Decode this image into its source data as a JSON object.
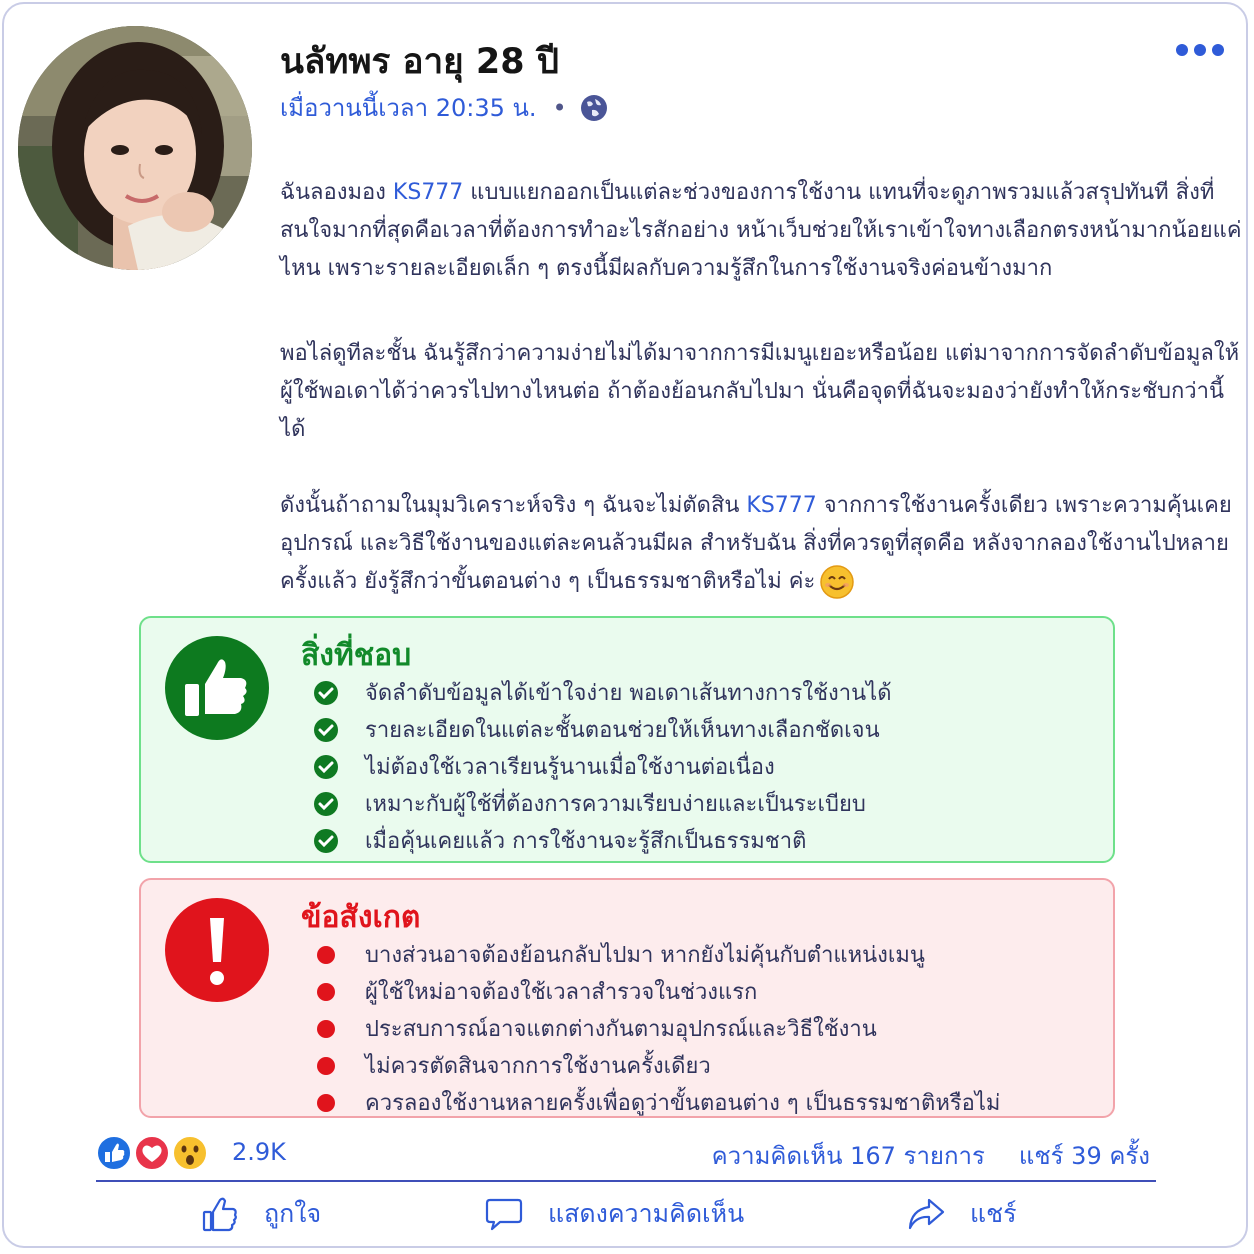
{
  "post": {
    "author": "นลัทพร อายุ 28 ปี",
    "time": "เมื่อวานนี้เวลา 20:35 น.",
    "separator": "•"
  },
  "content": {
    "p1_a": "ฉันลองมอง ",
    "p1_brand": "KS777",
    "p1_b": " แบบแยกออกเป็นแต่ละช่วงของการใช้งาน แทนที่จะดูภาพรวมแล้วสรุปทันที สิ่งที่สนใจมากที่สุดคือเวลาที่ต้องการทำอะไรสักอย่าง หน้าเว็บช่วยให้เราเข้าใจทางเลือกตรงหน้ามากน้อยแค่ไหน เพราะรายละเอียดเล็ก ๆ ตรงนี้มีผลกับความรู้สึกในการใช้งานจริงค่อนข้างมาก",
    "p2": "พอไล่ดูทีละชั้น ฉันรู้สึกว่าความง่ายไม่ได้มาจากการมีเมนูเยอะหรือน้อย แต่มาจากการจัดลำดับข้อมูลให้ผู้ใช้พอเดาได้ว่าควรไปทางไหนต่อ ถ้าต้องย้อนกลับไปมา นั่นคือจุดที่ฉันจะมองว่ายังทำให้กระชับกว่านี้ได้",
    "p3_a": "ดังนั้นถ้าถามในมุมวิเคราะห์จริง ๆ ฉันจะไม่ตัดสิน ",
    "p3_brand": "KS777",
    "p3_b": " จากการใช้งานครั้งเดียว เพราะความคุ้นเคย อุปกรณ์ และวิธีใช้งานของแต่ละคนล้วนมีผล สำหรับฉัน สิ่งที่ควรดูที่สุดคือ หลังจากลองใช้งานไปหลายครั้งแล้ว ยังรู้สึกว่าขั้นตอนต่าง ๆ เป็นธรรมชาติหรือไม่ ค่ะ"
  },
  "likes_box": {
    "title": "สิ่งที่ชอบ",
    "items": [
      "จัดลำดับข้อมูลได้เข้าใจง่าย พอเดาเส้นทางการใช้งานได้",
      "รายละเอียดในแต่ละชั้นตอนช่วยให้เห็นทางเลือกชัดเจน",
      "ไม่ต้องใช้เวลาเรียนรู้นานเมื่อใช้งานต่อเนื่อง",
      "เหมาะกับผู้ใช้ที่ต้องการความเรียบง่ายและเป็นระเบียบ",
      "เมื่อคุ้นเคยแล้ว การใช้งานจะรู้สึกเป็นธรรมชาติ"
    ]
  },
  "notes_box": {
    "title": "ข้อสังเกต",
    "items": [
      "บางส่วนอาจต้องย้อนกลับไปมา หากยังไม่คุ้นกับตำแหน่งเมนู",
      "ผู้ใช้ใหม่อาจต้องใช้เวลาสำรวจในช่วงแรก",
      "ประสบการณ์อาจแตกต่างกันตามอุปกรณ์และวิธีใช้งาน",
      "ไม่ควรตัดสินจากการใช้งานครั้งเดียว",
      "ควรลองใช้งานหลายครั้งเพื่อดูว่าขั้นตอนต่าง ๆ เป็นธรรมชาติหรือไม่"
    ]
  },
  "stats": {
    "reactions": "2.9K",
    "comments": "ความคิดเห็น 167 รายการ",
    "shares": "แชร์ 39 ครั้ง"
  },
  "actions": {
    "like": "ถูกใจ",
    "comment": "แสดงความคิดเห็น",
    "share": "แชร์"
  },
  "icons": {
    "avatar": "profile-photo",
    "privacy": "globe-icon",
    "more": "more-options-icon",
    "emoji": "smiling-face-icon",
    "likes_box": "thumbs-up-icon",
    "notes_box": "exclamation-icon",
    "check": "check-circle-icon",
    "bullet": "red-dot-icon",
    "reactions": [
      "like-reaction-icon",
      "love-reaction-icon",
      "wow-reaction-icon"
    ]
  },
  "colors": {
    "accent_blue": "#2f5bd8",
    "positive_green": "#0f7a22",
    "warning_red": "#e0141c",
    "text": "#30345c"
  }
}
